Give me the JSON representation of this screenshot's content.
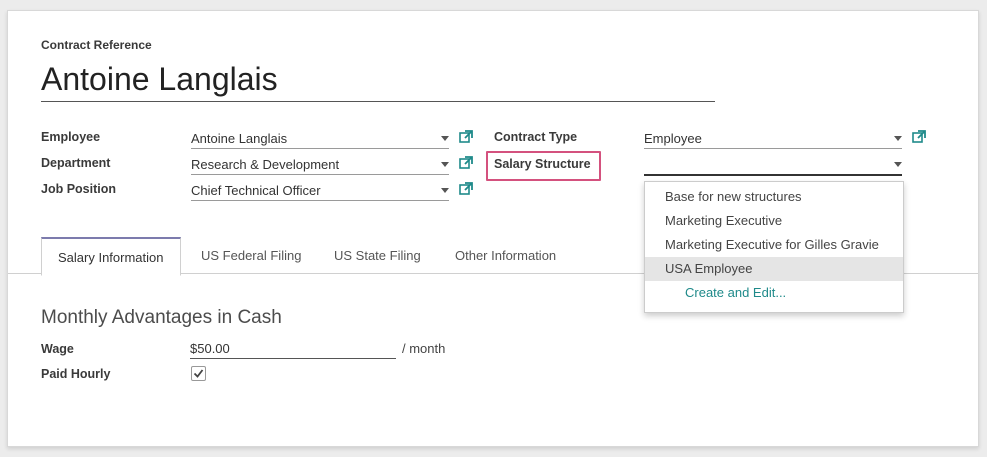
{
  "header": {
    "ref_label": "Contract Reference",
    "title": "Antoine Langlais"
  },
  "fields_left": {
    "employee": {
      "label": "Employee",
      "value": "Antoine Langlais"
    },
    "department": {
      "label": "Department",
      "value": "Research & Development"
    },
    "job_position": {
      "label": "Job Position",
      "value": "Chief Technical Officer"
    }
  },
  "fields_right": {
    "contract_type": {
      "label": "Contract Type",
      "value": "Employee"
    },
    "salary_structure": {
      "label": "Salary Structure",
      "value": ""
    }
  },
  "dropdown": {
    "items": [
      "Base for new structures",
      "Marketing Executive",
      "Marketing Executive for Gilles Gravie",
      "USA Employee"
    ],
    "selected_index": 3,
    "create_label": "Create and Edit..."
  },
  "tabs": [
    {
      "label": "Salary Information",
      "active": true
    },
    {
      "label": "US Federal Filing",
      "active": false
    },
    {
      "label": "US State Filing",
      "active": false
    },
    {
      "label": "Other Information",
      "active": false
    }
  ],
  "section": {
    "title": "Monthly Advantages in Cash",
    "wage_label": "Wage",
    "wage_value": "$50.00",
    "wage_unit": "/ month",
    "paid_hourly_label": "Paid Hourly",
    "paid_hourly_checked": true
  },
  "colors": {
    "accent": "#7c7bad",
    "link": "#1f8a8a",
    "highlight": "#d4517e"
  },
  "icons": {
    "external_link": "external-link-icon",
    "caret": "chevron-down-icon",
    "check": "checkmark-icon"
  }
}
